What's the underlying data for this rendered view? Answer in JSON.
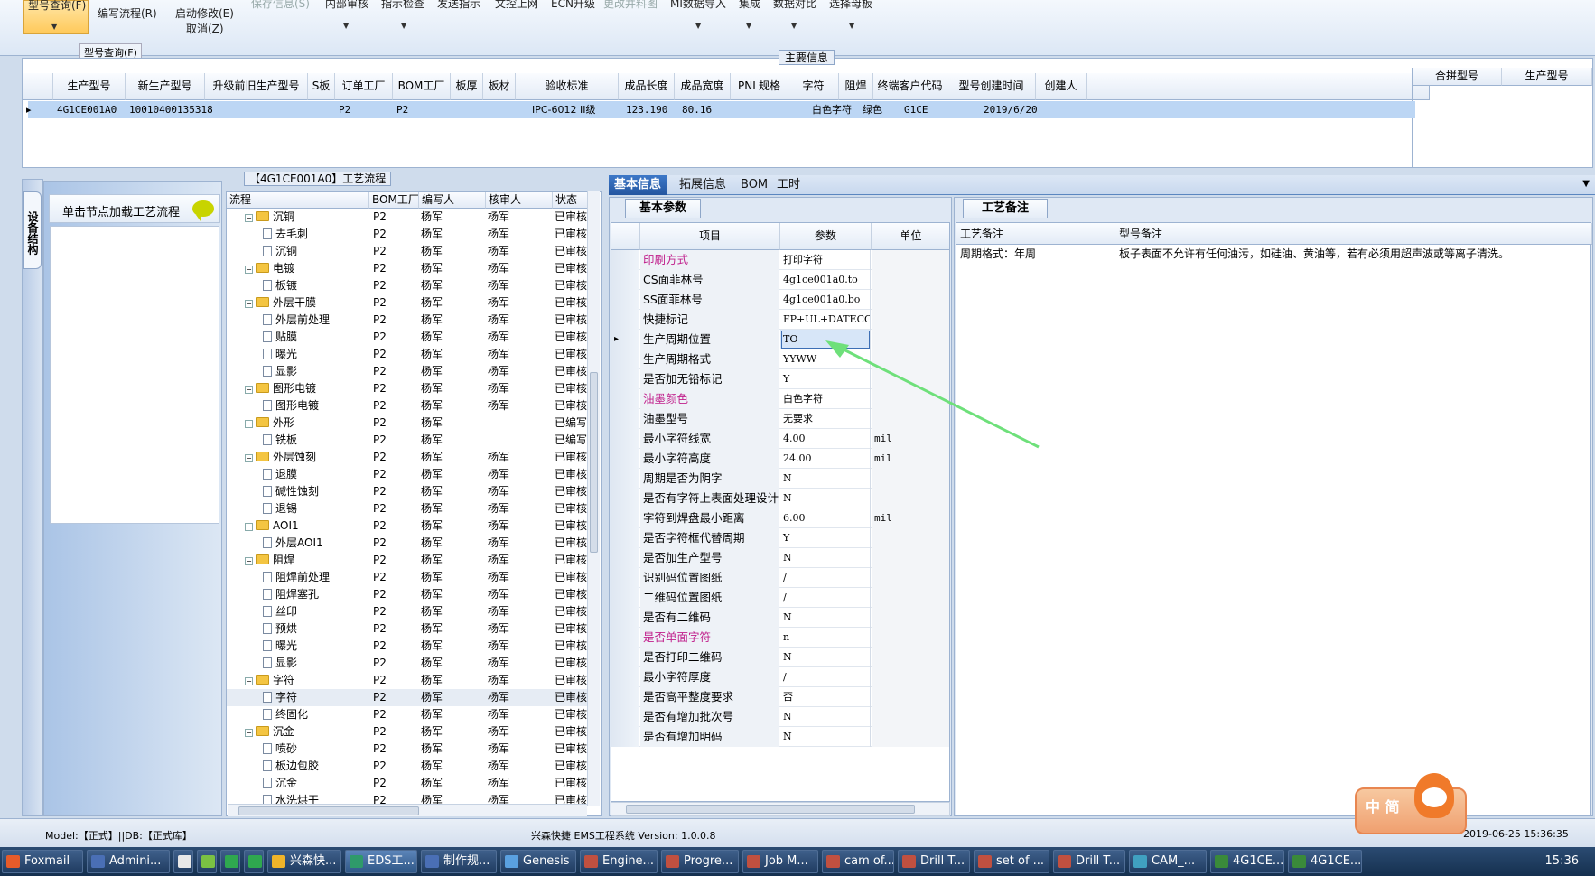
{
  "ribbon": {
    "active_item": "型号查询(F)",
    "items": [
      "编写流程(R)",
      "启动修改(E)",
      "取消(Z)",
      "保存信息(S)",
      "内部审核",
      "指示检查",
      "发送指示",
      "文控上网",
      "ECN升级",
      "更改并料图",
      "MI数据导入",
      "集成",
      "数据对比",
      "选择母板"
    ],
    "group_label": "型号查询(F)"
  },
  "main_info": {
    "title": "主要信息",
    "columns": [
      "生产型号",
      "新生产型号",
      "升级前旧生产型号",
      "S板",
      "订单工厂",
      "BOM工厂",
      "板厚",
      "板材",
      "验收标准",
      "成品长度",
      "成品宽度",
      "PNL规格",
      "字符",
      "阻焊",
      "终端客户代码",
      "型号创建时间",
      "创建人"
    ],
    "row": [
      "4G1CE001A0",
      "10010400135318",
      "",
      "",
      "P2",
      "P2",
      "",
      "",
      "IPC-6012 II级",
      "123.190",
      "80.16",
      "",
      "白色字符",
      "绿色",
      "G1CE",
      "2019/6/20",
      ""
    ],
    "right_columns": [
      "合拼型号",
      "生产型号"
    ]
  },
  "left_strip": {
    "tab_label": "设备结构"
  },
  "left_panel": {
    "load_button": "单击节点加载工艺流程"
  },
  "flow": {
    "title": "【4G1CE001A0】工艺流程",
    "columns": [
      "流程",
      "BOM工厂",
      "编写人",
      "核审人",
      "状态"
    ],
    "rows": [
      {
        "name": "沉铜",
        "level": 0,
        "bom": "P2",
        "writer": "杨军",
        "reviewer": "杨军",
        "status": "已审核"
      },
      {
        "name": "去毛刺",
        "level": 1,
        "bom": "P2",
        "writer": "杨军",
        "reviewer": "杨军",
        "status": "已审核"
      },
      {
        "name": "沉铜",
        "level": 1,
        "bom": "P2",
        "writer": "杨军",
        "reviewer": "杨军",
        "status": "已审核"
      },
      {
        "name": "电镀",
        "level": 0,
        "bom": "P2",
        "writer": "杨军",
        "reviewer": "杨军",
        "status": "已审核"
      },
      {
        "name": "板镀",
        "level": 1,
        "bom": "P2",
        "writer": "杨军",
        "reviewer": "杨军",
        "status": "已审核"
      },
      {
        "name": "外层干膜",
        "level": 0,
        "bom": "P2",
        "writer": "杨军",
        "reviewer": "杨军",
        "status": "已审核"
      },
      {
        "name": "外层前处理",
        "level": 1,
        "bom": "P2",
        "writer": "杨军",
        "reviewer": "杨军",
        "status": "已审核"
      },
      {
        "name": "贴膜",
        "level": 1,
        "bom": "P2",
        "writer": "杨军",
        "reviewer": "杨军",
        "status": "已审核"
      },
      {
        "name": "曝光",
        "level": 1,
        "bom": "P2",
        "writer": "杨军",
        "reviewer": "杨军",
        "status": "已审核"
      },
      {
        "name": "显影",
        "level": 1,
        "bom": "P2",
        "writer": "杨军",
        "reviewer": "杨军",
        "status": "已审核"
      },
      {
        "name": "图形电镀",
        "level": 0,
        "bom": "P2",
        "writer": "杨军",
        "reviewer": "杨军",
        "status": "已审核"
      },
      {
        "name": "图形电镀",
        "level": 1,
        "bom": "P2",
        "writer": "杨军",
        "reviewer": "杨军",
        "status": "已审核"
      },
      {
        "name": "外形",
        "level": 0,
        "bom": "P2",
        "writer": "杨军",
        "reviewer": "",
        "status": "已编写"
      },
      {
        "name": "铣板",
        "level": 1,
        "bom": "P2",
        "writer": "杨军",
        "reviewer": "",
        "status": "已编写"
      },
      {
        "name": "外层蚀刻",
        "level": 0,
        "bom": "P2",
        "writer": "杨军",
        "reviewer": "杨军",
        "status": "已审核"
      },
      {
        "name": "退膜",
        "level": 1,
        "bom": "P2",
        "writer": "杨军",
        "reviewer": "杨军",
        "status": "已审核"
      },
      {
        "name": "碱性蚀刻",
        "level": 1,
        "bom": "P2",
        "writer": "杨军",
        "reviewer": "杨军",
        "status": "已审核"
      },
      {
        "name": "退锡",
        "level": 1,
        "bom": "P2",
        "writer": "杨军",
        "reviewer": "杨军",
        "status": "已审核"
      },
      {
        "name": "AOI1",
        "level": 0,
        "bom": "P2",
        "writer": "杨军",
        "reviewer": "杨军",
        "status": "已审核"
      },
      {
        "name": "外层AOI1",
        "level": 1,
        "bom": "P2",
        "writer": "杨军",
        "reviewer": "杨军",
        "status": "已审核"
      },
      {
        "name": "阻焊",
        "level": 0,
        "bom": "P2",
        "writer": "杨军",
        "reviewer": "杨军",
        "status": "已审核"
      },
      {
        "name": "阻焊前处理",
        "level": 1,
        "bom": "P2",
        "writer": "杨军",
        "reviewer": "杨军",
        "status": "已审核"
      },
      {
        "name": "阻焊塞孔",
        "level": 1,
        "bom": "P2",
        "writer": "杨军",
        "reviewer": "杨军",
        "status": "已审核"
      },
      {
        "name": "丝印",
        "level": 1,
        "bom": "P2",
        "writer": "杨军",
        "reviewer": "杨军",
        "status": "已审核"
      },
      {
        "name": "预烘",
        "level": 1,
        "bom": "P2",
        "writer": "杨军",
        "reviewer": "杨军",
        "status": "已审核"
      },
      {
        "name": "曝光",
        "level": 1,
        "bom": "P2",
        "writer": "杨军",
        "reviewer": "杨军",
        "status": "已审核"
      },
      {
        "name": "显影",
        "level": 1,
        "bom": "P2",
        "writer": "杨军",
        "reviewer": "杨军",
        "status": "已审核"
      },
      {
        "name": "字符",
        "level": 0,
        "bom": "P2",
        "writer": "杨军",
        "reviewer": "杨军",
        "status": "已审核"
      },
      {
        "name": "字符",
        "level": 1,
        "bom": "P2",
        "writer": "杨军",
        "reviewer": "杨军",
        "status": "已审核",
        "selected": true
      },
      {
        "name": "终固化",
        "level": 1,
        "bom": "P2",
        "writer": "杨军",
        "reviewer": "杨军",
        "status": "已审核"
      },
      {
        "name": "沉金",
        "level": 0,
        "bom": "P2",
        "writer": "杨军",
        "reviewer": "杨军",
        "status": "已审核"
      },
      {
        "name": "喷砂",
        "level": 1,
        "bom": "P2",
        "writer": "杨军",
        "reviewer": "杨军",
        "status": "已审核"
      },
      {
        "name": "板边包胶",
        "level": 1,
        "bom": "P2",
        "writer": "杨军",
        "reviewer": "杨军",
        "status": "已审核"
      },
      {
        "name": "沉金",
        "level": 1,
        "bom": "P2",
        "writer": "杨军",
        "reviewer": "杨军",
        "status": "已审核"
      },
      {
        "name": "水洗烘干",
        "level": 1,
        "bom": "P2",
        "writer": "杨军",
        "reviewer": "杨军",
        "status": "已审核"
      }
    ]
  },
  "tabs": [
    "基本信息",
    "拓展信息",
    "BOM",
    "工时"
  ],
  "basic": {
    "tab": "基本参数",
    "columns": [
      "项目",
      "参数",
      "单位"
    ],
    "rows": [
      {
        "name": "印刷方式",
        "value": "打印字符",
        "unit": "",
        "pink": true
      },
      {
        "name": "CS面菲林号",
        "value": "4g1ce001a0.to",
        "unit": ""
      },
      {
        "name": "SS面菲林号",
        "value": "4g1ce001a0.bo",
        "unit": ""
      },
      {
        "name": "快捷标记",
        "value": "FP+UL+DATECODE",
        "unit": ""
      },
      {
        "name": "生产周期位置",
        "value": "TO",
        "unit": "",
        "current": true
      },
      {
        "name": "生产周期格式",
        "value": "YYWW",
        "unit": ""
      },
      {
        "name": "是否加无铅标记",
        "value": "Y",
        "unit": ""
      },
      {
        "name": "油墨颜色",
        "value": "白色字符",
        "unit": "",
        "pink": true
      },
      {
        "name": "油墨型号",
        "value": "无要求",
        "unit": ""
      },
      {
        "name": "最小字符线宽",
        "value": "4.00",
        "unit": "mil"
      },
      {
        "name": "最小字符高度",
        "value": "24.00",
        "unit": "mil"
      },
      {
        "name": "周期是否为阴字",
        "value": "N",
        "unit": ""
      },
      {
        "name": "是否有字符上表面处理设计",
        "value": "N",
        "unit": ""
      },
      {
        "name": "字符到焊盘最小距离",
        "value": "6.00",
        "unit": "mil"
      },
      {
        "name": "是否字符框代替周期",
        "value": "Y",
        "unit": ""
      },
      {
        "name": "是否加生产型号",
        "value": "N",
        "unit": ""
      },
      {
        "name": "识别码位置图纸",
        "value": "/",
        "unit": ""
      },
      {
        "name": "二维码位置图纸",
        "value": "/",
        "unit": ""
      },
      {
        "name": "是否有二维码",
        "value": "N",
        "unit": ""
      },
      {
        "name": "是否单面字符",
        "value": "n",
        "unit": "",
        "pink": true
      },
      {
        "name": "是否打印二维码",
        "value": "N",
        "unit": ""
      },
      {
        "name": "最小字符厚度",
        "value": "/",
        "unit": ""
      },
      {
        "name": "是否高平整度要求",
        "value": "否",
        "unit": ""
      },
      {
        "name": "是否有增加批次号",
        "value": "N",
        "unit": ""
      },
      {
        "name": "是否有增加明码",
        "value": "N",
        "unit": ""
      }
    ]
  },
  "notes": {
    "tab": "工艺备注",
    "columns": [
      "工艺备注",
      "型号备注"
    ],
    "process_note": "周期格式：年周",
    "model_note": "板子表面不允许有任何油污，如硅油、黄油等，若有必须用超声波或等离子清洗。"
  },
  "status": {
    "model": "Model:【正式】||DB:【正式库】",
    "app": "兴森快捷 EMS工程系统 Version: 1.0.0.8",
    "datetime": "2019-06-25 15:36:35",
    "ime": "中 简"
  },
  "taskbar": {
    "items": [
      "Foxmail",
      "Admini...",
      "",
      "",
      "",
      "",
      "兴森快...",
      "EDS工...",
      "制作规...",
      "Genesis",
      "Engine...",
      "Progre...",
      "Job M...",
      "cam of...",
      "Drill T...",
      "set of ...",
      "Drill T...",
      "CAM_...",
      "4G1CE...",
      "4G1CE..."
    ],
    "clock": "15:36"
  },
  "colors": {
    "accent": "#2456a0",
    "pink_label": "#c0208c",
    "arrow": "#6ee07a"
  }
}
